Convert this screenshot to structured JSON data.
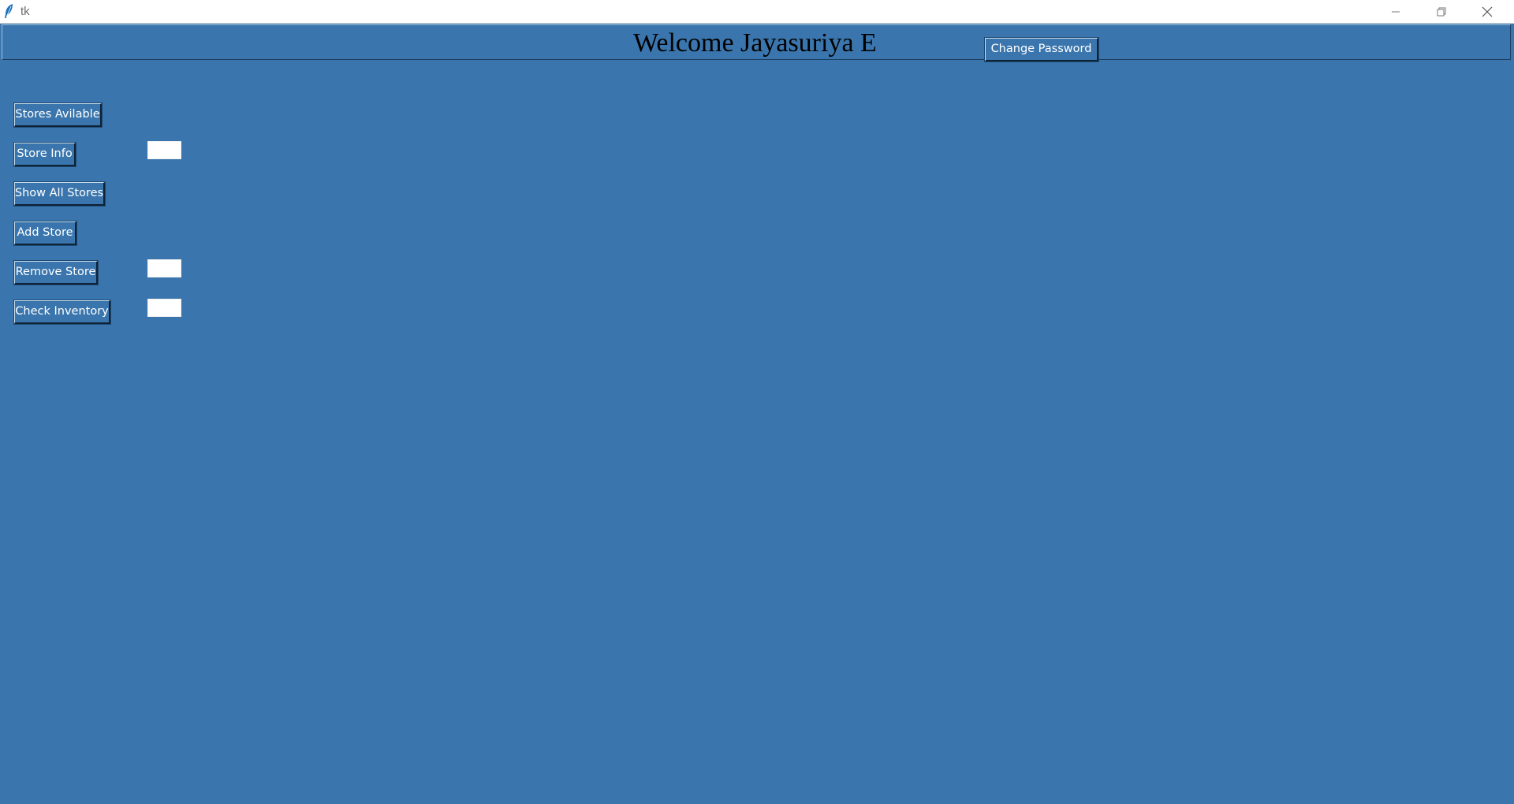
{
  "window": {
    "title": "tk",
    "controls": {
      "minimize_icon": "minimize-icon",
      "maximize_icon": "restore-icon",
      "close_icon": "close-icon"
    }
  },
  "header": {
    "welcome_text": "Welcome Jayasuriya E",
    "change_password_label": "Change Password"
  },
  "actions": {
    "stores_available_label": "Stores Avilable",
    "store_info_label": "Store Info",
    "show_all_stores_label": "Show All Stores",
    "add_store_label": "Add Store",
    "remove_store_label": "Remove Store",
    "check_inventory_label": "Check Inventory"
  },
  "inputs": {
    "store_info_value": "",
    "remove_store_value": "",
    "check_inventory_value": ""
  },
  "colors": {
    "background": "#3a76ad",
    "title_bar": "#ffffff",
    "button_text": "#ffffff",
    "heading_text": "#000000"
  }
}
